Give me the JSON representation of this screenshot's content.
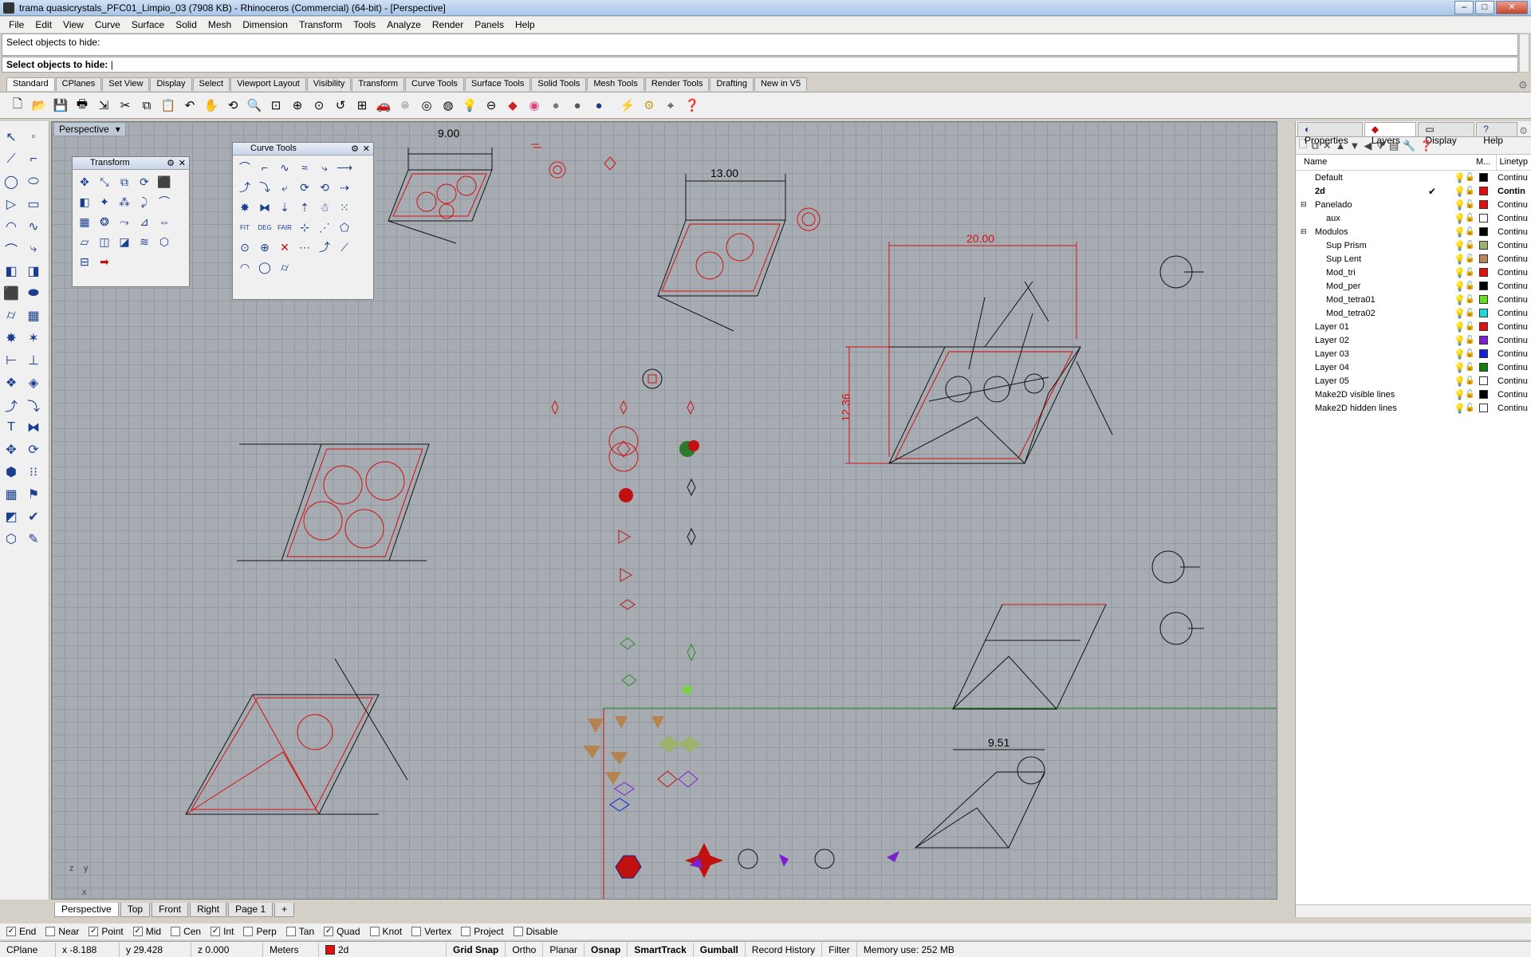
{
  "window": {
    "title": "trama quasicrystals_PFC01_Limpio_03 (7908 KB) - Rhinoceros (Commercial) (64-bit) - [Perspective]",
    "buttons": [
      "–",
      "□",
      "✕"
    ]
  },
  "menu": [
    "File",
    "Edit",
    "View",
    "Curve",
    "Surface",
    "Solid",
    "Mesh",
    "Dimension",
    "Transform",
    "Tools",
    "Analyze",
    "Render",
    "Panels",
    "Help"
  ],
  "command": {
    "history": "Select objects to hide:",
    "prompt": "Select objects to hide:"
  },
  "toolbar_tabs": [
    "Standard",
    "CPlanes",
    "Set View",
    "Display",
    "Select",
    "Viewport Layout",
    "Visibility",
    "Transform",
    "Curve Tools",
    "Surface Tools",
    "Solid Tools",
    "Mesh Tools",
    "Render Tools",
    "Drafting",
    "New in V5"
  ],
  "viewport": {
    "title": "Perspective",
    "dims": {
      "d1": "9.00",
      "d2": "13.00",
      "d3": "20.00",
      "d4": "12.36",
      "d5": "9.51"
    },
    "axis": {
      "y": "y",
      "z": "z",
      "x": "x"
    }
  },
  "floating_panels": {
    "transform": {
      "title": "Transform"
    },
    "curve_tools": {
      "title": "Curve Tools",
      "labels": [
        "FIT",
        "DEG",
        "FAIR"
      ]
    }
  },
  "viewport_tabs": [
    "Perspective",
    "Top",
    "Front",
    "Right",
    "Page 1"
  ],
  "osnap": [
    {
      "label": "End",
      "checked": true
    },
    {
      "label": "Near",
      "checked": false
    },
    {
      "label": "Point",
      "checked": true
    },
    {
      "label": "Mid",
      "checked": true
    },
    {
      "label": "Cen",
      "checked": false
    },
    {
      "label": "Int",
      "checked": true
    },
    {
      "label": "Perp",
      "checked": false
    },
    {
      "label": "Tan",
      "checked": false
    },
    {
      "label": "Quad",
      "checked": true
    },
    {
      "label": "Knot",
      "checked": false
    },
    {
      "label": "Vertex",
      "checked": false
    },
    {
      "label": "Project",
      "checked": false
    },
    {
      "label": "Disable",
      "checked": false
    }
  ],
  "status": {
    "cplane": "CPlane",
    "x": "x -8.188",
    "y": "y 29.428",
    "z": "z 0.000",
    "units": "Meters",
    "layer": "2d",
    "layer_color": "#e01010",
    "toggles": [
      "Grid Snap",
      "Ortho",
      "Planar",
      "Osnap",
      "SmartTrack",
      "Gumball",
      "Record History",
      "Filter"
    ],
    "memory": "Memory use: 252 MB"
  },
  "right_panel": {
    "tabs": [
      "Properties",
      "Layers",
      "Display",
      "Help"
    ],
    "header": {
      "name": "Name",
      "m": "M...",
      "linetype": "Linetyp"
    },
    "layers": [
      {
        "name": "Default",
        "indent": 0,
        "color": "#000000",
        "linetype": "Continu",
        "current": false,
        "expander": ""
      },
      {
        "name": "2d",
        "indent": 0,
        "color": "#e01010",
        "linetype": "Contin",
        "current": true,
        "expander": ""
      },
      {
        "name": "Panelado",
        "indent": 0,
        "color": "#e01010",
        "linetype": "Continu",
        "current": false,
        "expander": "⊟"
      },
      {
        "name": "aux",
        "indent": 1,
        "color": "#ffffff",
        "linetype": "Continu",
        "current": false,
        "expander": ""
      },
      {
        "name": "Modulos",
        "indent": 0,
        "color": "#000000",
        "linetype": "Continu",
        "current": false,
        "expander": "⊟"
      },
      {
        "name": "Sup Prism",
        "indent": 1,
        "color": "#9bb36b",
        "linetype": "Continu",
        "current": false,
        "expander": ""
      },
      {
        "name": "Sup Lent",
        "indent": 1,
        "color": "#b7865a",
        "linetype": "Continu",
        "current": false,
        "expander": ""
      },
      {
        "name": "Mod_tri",
        "indent": 1,
        "color": "#e01010",
        "linetype": "Continu",
        "current": false,
        "expander": ""
      },
      {
        "name": "Mod_per",
        "indent": 1,
        "color": "#000000",
        "linetype": "Continu",
        "current": false,
        "expander": ""
      },
      {
        "name": "Mod_tetra01",
        "indent": 1,
        "color": "#66e020",
        "linetype": "Continu",
        "current": false,
        "expander": ""
      },
      {
        "name": "Mod_tetra02",
        "indent": 1,
        "color": "#20d8e0",
        "linetype": "Continu",
        "current": false,
        "expander": ""
      },
      {
        "name": "Layer 01",
        "indent": 0,
        "color": "#e01010",
        "linetype": "Continu",
        "current": false,
        "expander": ""
      },
      {
        "name": "Layer 02",
        "indent": 0,
        "color": "#7a20d0",
        "linetype": "Continu",
        "current": false,
        "expander": ""
      },
      {
        "name": "Layer 03",
        "indent": 0,
        "color": "#1020d8",
        "linetype": "Continu",
        "current": false,
        "expander": ""
      },
      {
        "name": "Layer 04",
        "indent": 0,
        "color": "#108010",
        "linetype": "Continu",
        "current": false,
        "expander": ""
      },
      {
        "name": "Layer 05",
        "indent": 0,
        "color": "#ffffff",
        "linetype": "Continu",
        "current": false,
        "expander": ""
      },
      {
        "name": "Make2D visible lines",
        "indent": 0,
        "color": "#000000",
        "linetype": "Continu",
        "current": false,
        "expander": ""
      },
      {
        "name": "Make2D hidden lines",
        "indent": 0,
        "color": "#ffffff",
        "linetype": "Continu",
        "current": false,
        "expander": ""
      }
    ]
  }
}
